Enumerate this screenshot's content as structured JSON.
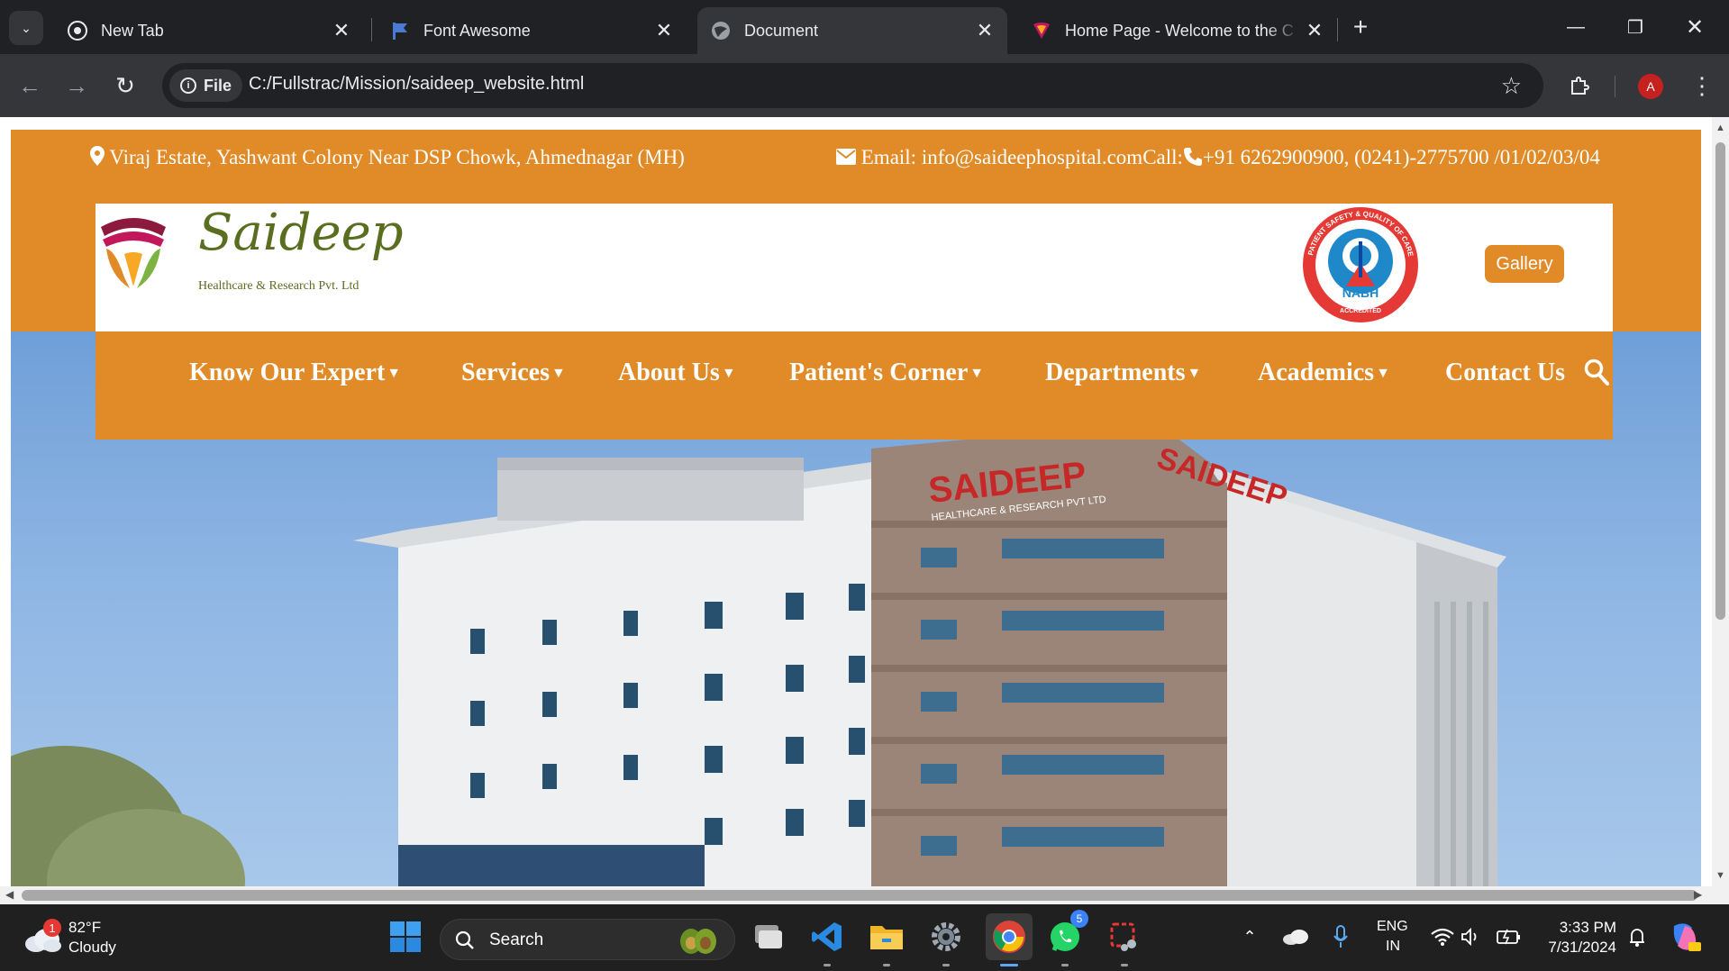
{
  "browser": {
    "tabs": [
      {
        "title": "New Tab",
        "icon": "chrome-icon"
      },
      {
        "title": "Font Awesome",
        "icon": "flag-icon"
      },
      {
        "title": "Document",
        "icon": "globe-icon",
        "active": true
      },
      {
        "title": "Home Page - Welcome to the C",
        "icon": "site-icon"
      }
    ],
    "address": {
      "scheme_label": "File",
      "url": "C:/Fullstrac/Mission/saideep_website.html"
    },
    "profile_initial": "A"
  },
  "site": {
    "accent_color": "#e08b27",
    "topbar": {
      "address": "Viraj Estate, Yashwant Colony Near DSP Chowk, Ahmednagar (MH)",
      "contact": "Email: info@saideephospital.comCall:",
      "phones": "+91 6262900900, (0241)-2775700 /01/02/03/04"
    },
    "logo": {
      "name": "Saideep",
      "tagline": "Healthcare & Research Pvt. Ltd"
    },
    "accreditation": {
      "label": "NABH",
      "ring_text": "PATIENT SAFETY & QUALITY OF CARE",
      "bottom_text": "ACCREDITED"
    },
    "gallery_label": "Gallery",
    "nav": [
      {
        "label": "Know Our Expert"
      },
      {
        "label": "Services"
      },
      {
        "label": "About Us"
      },
      {
        "label": "Patient's Corner"
      },
      {
        "label": "Departments"
      },
      {
        "label": "Academics"
      },
      {
        "label": "Contact Us"
      }
    ],
    "hero": {
      "sign_primary": "SAIDEEP",
      "sign_secondary": "HEALTHCARE & RESEARCH PVT LTD",
      "sign_side": "SAIDEEP"
    }
  },
  "taskbar": {
    "weather": {
      "badge": "1",
      "temp": "82°F",
      "condition": "Cloudy"
    },
    "search_placeholder": "Search",
    "whatsapp_badge": "5",
    "language": {
      "line1": "ENG",
      "line2": "IN"
    },
    "clock": {
      "time": "3:33 PM",
      "date": "7/31/2024"
    }
  }
}
